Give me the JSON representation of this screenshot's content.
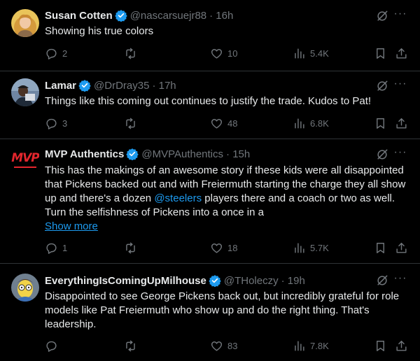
{
  "tweets": [
    {
      "name": "Susan Cotten",
      "handle": "@nascarsuejr88",
      "time": "· 16h",
      "text": "Showing his true colors",
      "replies": "2",
      "reposts": "",
      "likes": "10",
      "views": "5.4K"
    },
    {
      "name": "Lamar",
      "handle": "@DrDray35",
      "time": "· 17h",
      "text": "Things like this coming out continues to justify the trade. Kudos to Pat!",
      "replies": "3",
      "reposts": "",
      "likes": "48",
      "views": "6.8K"
    },
    {
      "name": "MVP Authentics",
      "handle": "@MVPAuthentics",
      "time": "· 15h",
      "avatar_text": "MVP",
      "text_before": "This has the makings of an awesome story if these kids were all disappointed that Pickens backed out and with Freiermuth starting the charge they all show up and there's a dozen ",
      "mention": "@steelers",
      "text_after": " players there and a coach or two as well. Turn the selfishness of Pickens into a once in a",
      "show_more": "Show more",
      "replies": "1",
      "reposts": "",
      "likes": "18",
      "views": "5.7K"
    },
    {
      "name": "EverythingIsComingUpMilhouse",
      "handle": "@THoleczy",
      "time": "· 19h",
      "text": "Disappointed to see George Pickens back out, but incredibly grateful for role models like Pat Freiermuth who show up and do the right thing. That's leadership.",
      "replies": "",
      "reposts": "",
      "likes": "83",
      "views": "7.8K"
    }
  ],
  "colors": {
    "background": "#000000",
    "text": "#e7e9ea",
    "secondary": "#71767b",
    "link": "#1d9bf0",
    "divider": "#2f3336"
  },
  "icons": [
    "reply-icon",
    "repost-icon",
    "like-icon",
    "views-icon",
    "bookmark-icon",
    "share-icon",
    "grok-icon",
    "more-icon",
    "verified-badge-icon"
  ]
}
